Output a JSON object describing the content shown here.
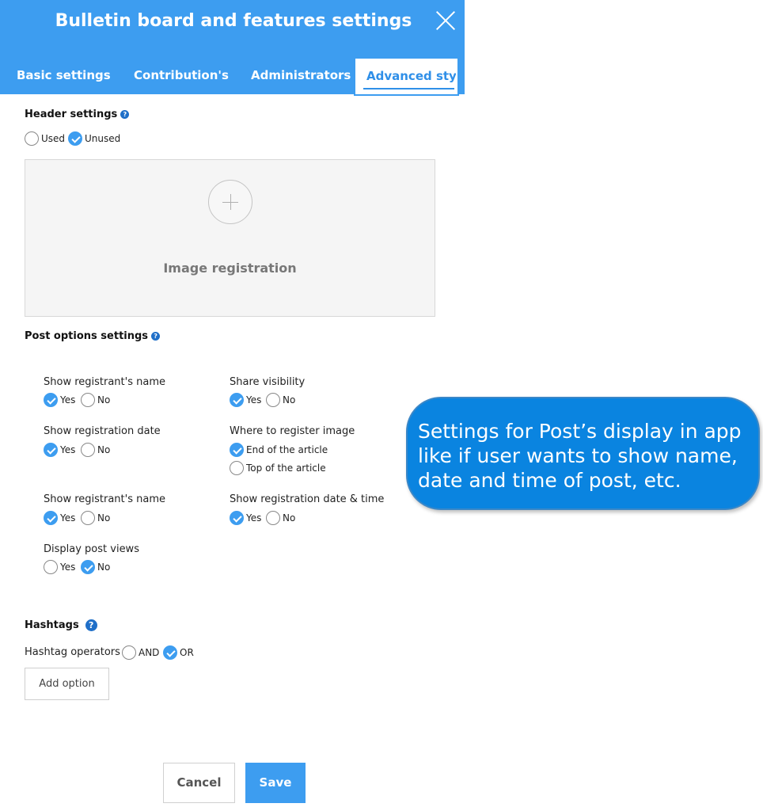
{
  "modal": {
    "title": "Bulletin board and features settings"
  },
  "tabs": [
    {
      "label": "Basic settings"
    },
    {
      "label": "Contribution's"
    },
    {
      "label": "Administrators"
    },
    {
      "label": "Advanced style",
      "active": true
    }
  ],
  "header_settings": {
    "title": "Header settings",
    "options": [
      "Used",
      "Unused"
    ],
    "selected": "Unused",
    "image_registration_label": "Image registration"
  },
  "post_options": {
    "title": "Post options settings",
    "show_name_1": {
      "label": "Show registrant's name",
      "yes": "Yes",
      "no": "No",
      "selected": "Yes"
    },
    "share_visibility": {
      "label": "Share visibility",
      "yes": "Yes",
      "no": "No",
      "selected": "Yes"
    },
    "show_reg_date": {
      "label": "Show registration date",
      "yes": "Yes",
      "no": "No",
      "selected": "Yes"
    },
    "image_position": {
      "label": "Where to register image",
      "end": "End of the article",
      "top": "Top of the article",
      "selected": "End of the article"
    },
    "show_name_2": {
      "label": "Show registrant's name",
      "yes": "Yes",
      "no": "No",
      "selected": "Yes"
    },
    "show_date_time": {
      "label": "Show registration date & time",
      "yes": "Yes",
      "no": "No",
      "selected": "Yes"
    },
    "display_views": {
      "label": "Display post views",
      "yes": "Yes",
      "no": "No",
      "selected": "No"
    }
  },
  "hashtags": {
    "title": "Hashtags",
    "operators_label": "Hashtag operators",
    "and": "AND",
    "or": "OR",
    "selected": "OR",
    "add_option": "Add option"
  },
  "footer": {
    "cancel": "Cancel",
    "save": "Save"
  },
  "callout": {
    "line1": "Settings for Post’s display in app",
    "line2": "like if user wants to show name,",
    "line3": "date and time of post, etc."
  },
  "colors": {
    "primary": "#3d9df0",
    "callout": "#0a84e0",
    "help_icon": "#1f6fc8"
  }
}
